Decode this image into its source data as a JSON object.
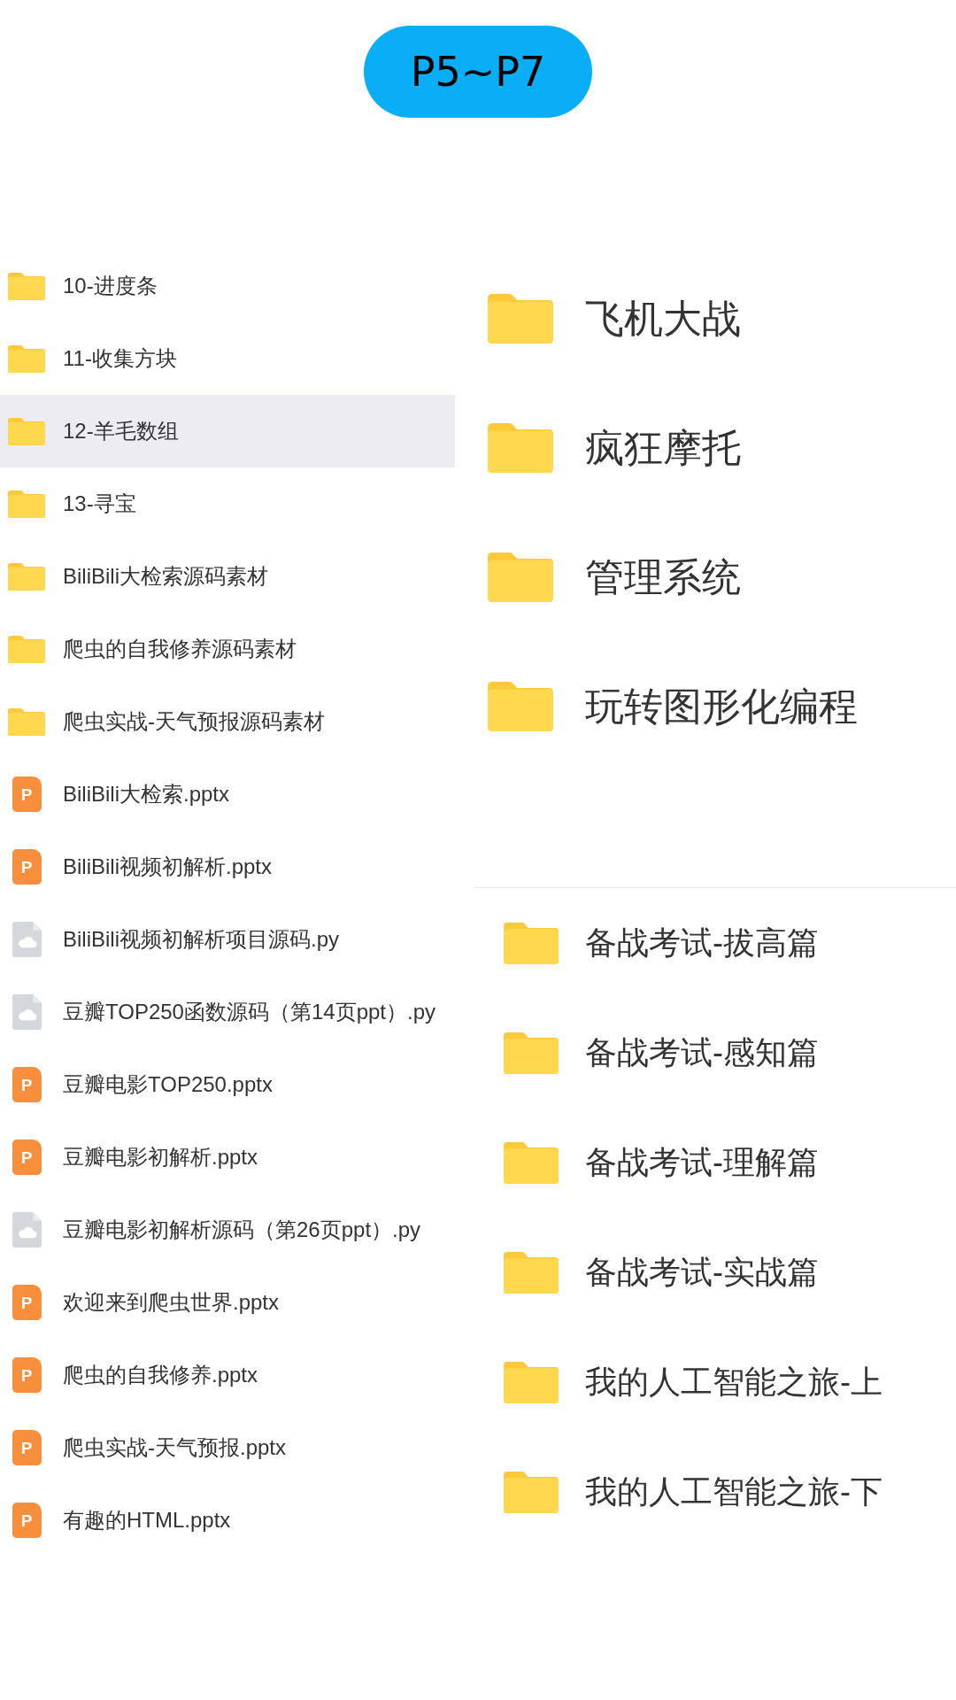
{
  "badge": {
    "label": "P5~P7"
  },
  "file_list": {
    "items": [
      {
        "kind": "folder",
        "name": "10-进度条",
        "selected": false
      },
      {
        "kind": "folder",
        "name": "11-收集方块",
        "selected": false
      },
      {
        "kind": "folder",
        "name": "12-羊毛数组",
        "selected": true
      },
      {
        "kind": "folder",
        "name": "13-寻宝",
        "selected": false
      },
      {
        "kind": "folder",
        "name": "BiliBili大检索源码素材",
        "selected": false
      },
      {
        "kind": "folder",
        "name": "爬虫的自我修养源码素材",
        "selected": false
      },
      {
        "kind": "folder",
        "name": "爬虫实战-天气预报源码素材",
        "selected": false
      },
      {
        "kind": "pptx",
        "icon_letter": "P",
        "name": "BiliBili大检索.pptx",
        "selected": false
      },
      {
        "kind": "pptx",
        "icon_letter": "P",
        "name": "BiliBili视频初解析.pptx",
        "selected": false
      },
      {
        "kind": "py",
        "name": "BiliBili视频初解析项目源码.py",
        "selected": false
      },
      {
        "kind": "py",
        "name": "豆瓣TOP250函数源码（第14页ppt）.py",
        "selected": false
      },
      {
        "kind": "pptx",
        "icon_letter": "P",
        "name": "豆瓣电影TOP250.pptx",
        "selected": false
      },
      {
        "kind": "pptx",
        "icon_letter": "P",
        "name": "豆瓣电影初解析.pptx",
        "selected": false
      },
      {
        "kind": "py",
        "name": "豆瓣电影初解析源码（第26页ppt）.py",
        "selected": false
      },
      {
        "kind": "pptx",
        "icon_letter": "P",
        "name": "欢迎来到爬虫世界.pptx",
        "selected": false
      },
      {
        "kind": "pptx",
        "icon_letter": "P",
        "name": "爬虫的自我修养.pptx",
        "selected": false
      },
      {
        "kind": "pptx",
        "icon_letter": "P",
        "name": "爬虫实战-天气预报.pptx",
        "selected": false
      },
      {
        "kind": "pptx",
        "icon_letter": "P",
        "name": "有趣的HTML.pptx",
        "selected": false
      }
    ]
  },
  "large_folders": {
    "items": [
      {
        "name": "飞机大战"
      },
      {
        "name": "疯狂摩托"
      },
      {
        "name": "管理系统"
      },
      {
        "name": "玩转图形化编程"
      }
    ]
  },
  "medium_folders": {
    "items": [
      {
        "name": "备战考试-拔高篇"
      },
      {
        "name": "备战考试-感知篇"
      },
      {
        "name": "备战考试-理解篇"
      },
      {
        "name": "备战考试-实战篇"
      },
      {
        "name": "我的人工智能之旅-上"
      },
      {
        "name": "我的人工智能之旅-下"
      }
    ]
  }
}
